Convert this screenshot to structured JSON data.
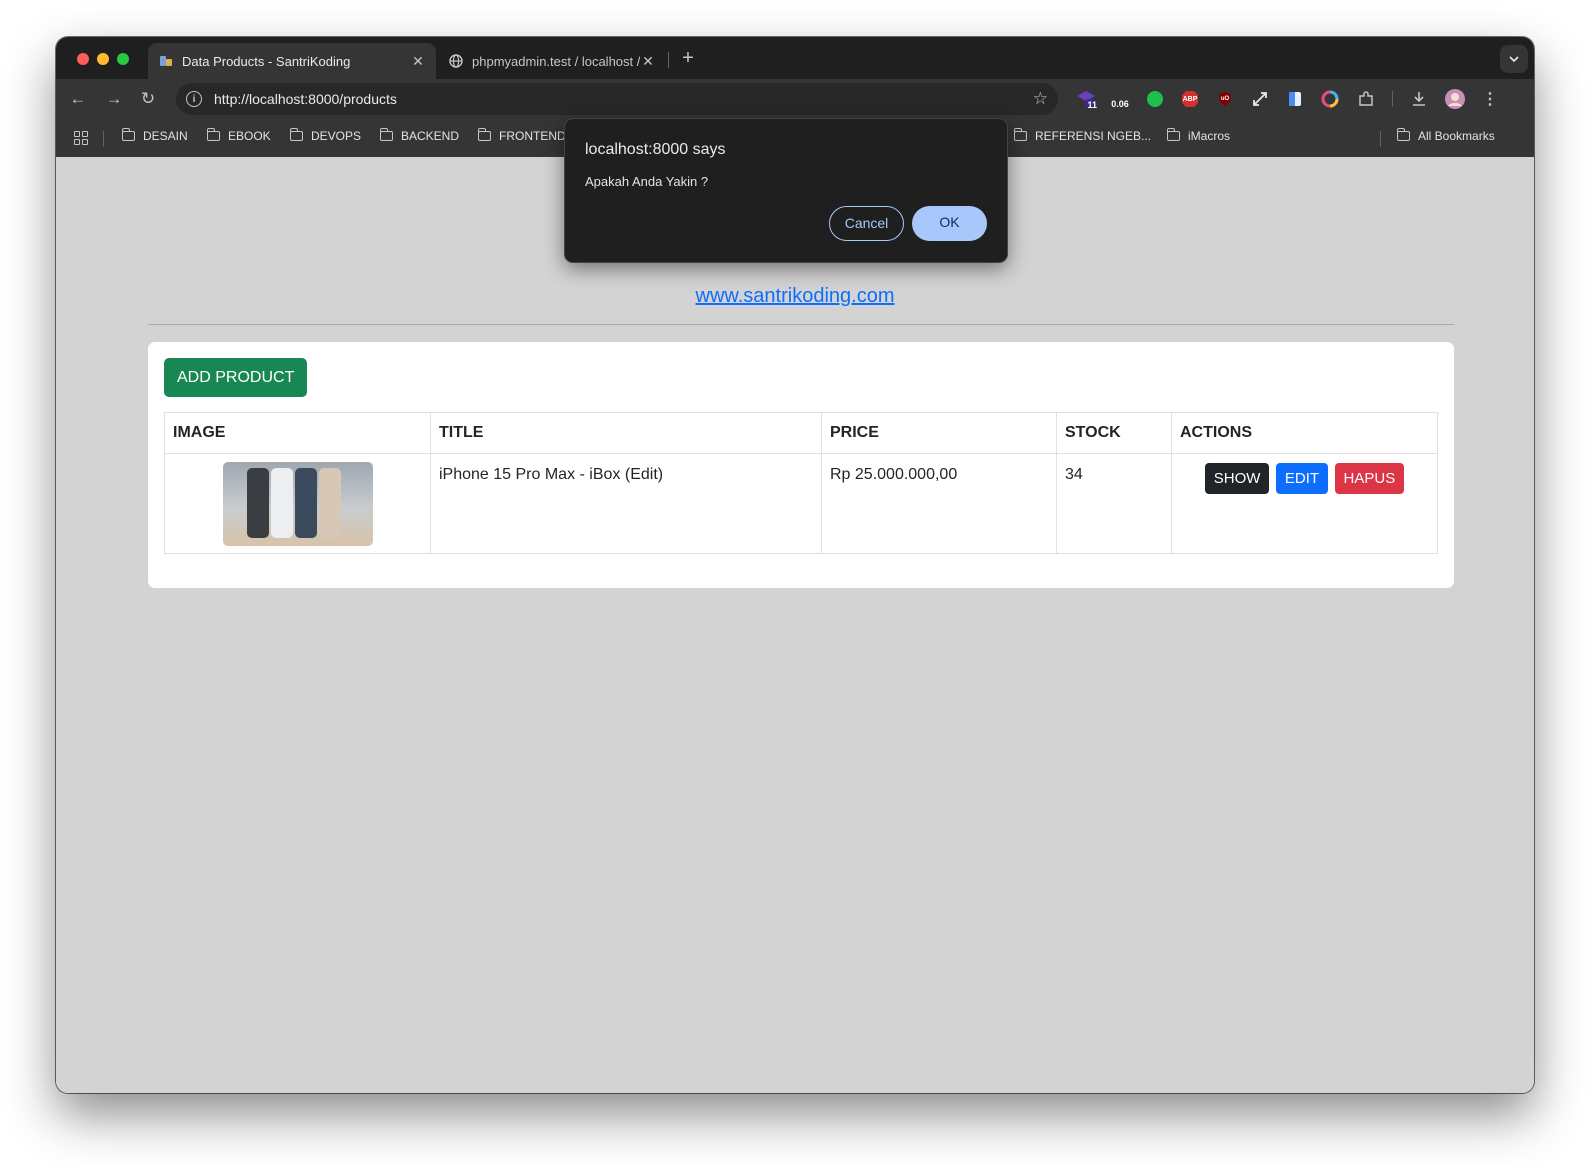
{
  "browser": {
    "tabs": [
      {
        "title": "Data Products - SantriKoding",
        "active": true
      },
      {
        "title": "phpmyadmin.test / localhost /",
        "active": false
      }
    ],
    "new_tab_symbol": "+",
    "address": "http://localhost:8000/products",
    "extension_badges": {
      "badge_11": "11",
      "badge_006": "0.06",
      "abp": "ABP",
      "ublock": "uO"
    },
    "bookmarks": [
      "DESAIN",
      "EBOOK",
      "DEVOPS",
      "BACKEND",
      "FRONTEND",
      "REFERENSI NGEB...",
      "iMacros"
    ],
    "all_bookmarks": "All Bookmarks"
  },
  "dialog": {
    "title": "localhost:8000 says",
    "message": "Apakah Anda Yakin ?",
    "cancel_label": "Cancel",
    "ok_label": "OK"
  },
  "page": {
    "site_link": "www.santrikoding.com",
    "add_button": "ADD PRODUCT",
    "table": {
      "headers": [
        "IMAGE",
        "TITLE",
        "PRICE",
        "STOCK",
        "ACTIONS"
      ],
      "rows": [
        {
          "title": "iPhone 15 Pro Max - iBox (Edit)",
          "price": "Rp 25.000.000,00",
          "stock": "34",
          "actions": {
            "show": "SHOW",
            "edit": "EDIT",
            "hapus": "HAPUS"
          }
        }
      ]
    }
  },
  "colors": {
    "success": "#198754",
    "primary": "#0d6efd",
    "danger": "#dc3545",
    "dark": "#212529",
    "dialog_accent": "#a8c7fa"
  }
}
